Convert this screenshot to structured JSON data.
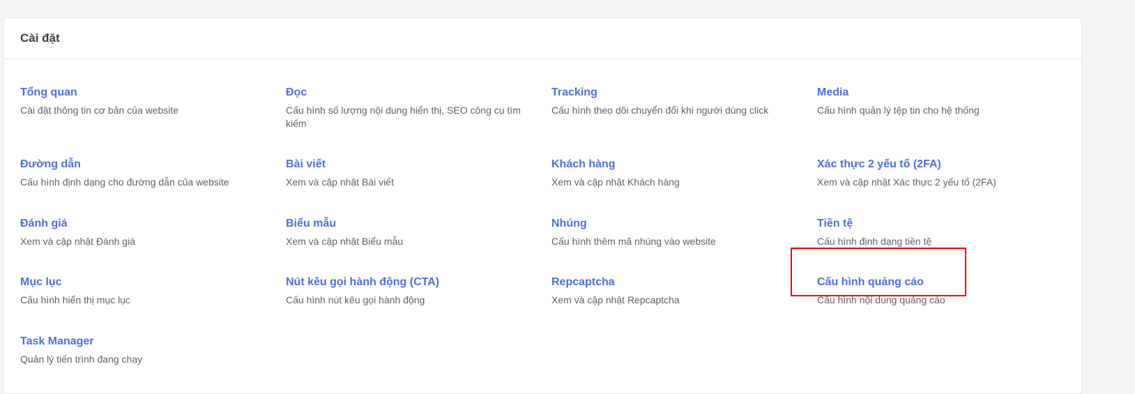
{
  "header": {
    "title": "Cài đặt"
  },
  "items": [
    {
      "title": "Tổng quan",
      "desc": "Cài đặt thông tin cơ bản của website"
    },
    {
      "title": "Đọc",
      "desc": "Cấu hình số lượng nội dung hiển thị, SEO công cụ tìm kiếm"
    },
    {
      "title": "Tracking",
      "desc": "Cấu hình theo dõi chuyển đổi khi người dùng click"
    },
    {
      "title": "Media",
      "desc": "Cấu hình quản lý tệp tin cho hệ thống"
    },
    {
      "title": "Đường dẫn",
      "desc": "Cấu hình định dạng cho đường dẫn của website"
    },
    {
      "title": "Bài viết",
      "desc": "Xem và cập nhật Bài viết"
    },
    {
      "title": "Khách hàng",
      "desc": "Xem và cập nhật Khách hàng"
    },
    {
      "title": "Xác thực 2 yếu tố (2FA)",
      "desc": "Xem và cập nhật Xác thực 2 yếu tố (2FA)"
    },
    {
      "title": "Đánh giá",
      "desc": "Xem và cập nhật Đánh giá"
    },
    {
      "title": "Biểu mẫu",
      "desc": "Xem và cập nhật Biểu mẫu"
    },
    {
      "title": "Nhúng",
      "desc": "Cấu hình thêm mã nhúng vào website"
    },
    {
      "title": "Tiền tệ",
      "desc": "Cấu hình định dạng tiền tệ"
    },
    {
      "title": "Mục lục",
      "desc": "Cấu hình hiển thị mục lục"
    },
    {
      "title": "Nút kêu gọi hành động (CTA)",
      "desc": "Cấu hình nút kêu gọi hành động"
    },
    {
      "title": "Repcaptcha",
      "desc": "Xem và cập nhật Repcaptcha"
    },
    {
      "title": "Cấu hình quảng cáo",
      "desc": "Cấu hình nội dung quảng cáo"
    },
    {
      "title": "Task Manager",
      "desc": "Quản lý tiến trình đang chạy"
    }
  ],
  "colors": {
    "link": "#4f6ee0",
    "highlight_border": "#ff0000"
  }
}
